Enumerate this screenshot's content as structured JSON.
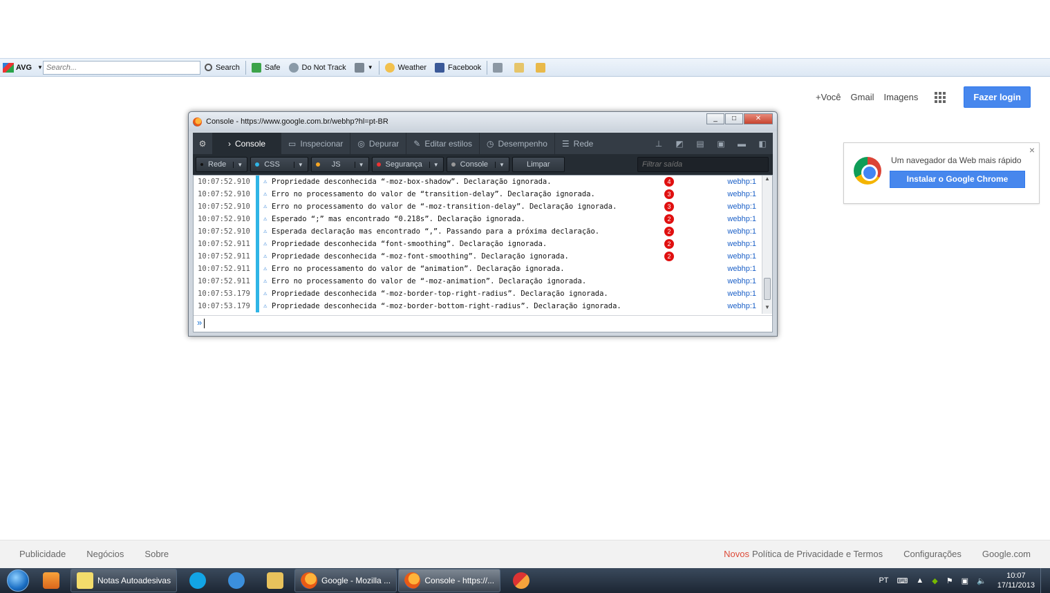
{
  "avg_toolbar": {
    "brand": "AVG",
    "search_placeholder": "Search...",
    "search_label": "Search",
    "safe_label": "Safe",
    "dnt_label": "Do Not Track",
    "weather_label": "Weather",
    "facebook_label": "Facebook"
  },
  "google_header": {
    "you_label": "+Você",
    "gmail_label": "Gmail",
    "images_label": "Imagens",
    "login_label": "Fazer login"
  },
  "chrome_promo": {
    "text": "Um navegador da Web mais rápido",
    "button_label": "Instalar o Google Chrome",
    "close": "×"
  },
  "console_window": {
    "title": "Console - https://www.google.com.br/webhp?hl=pt-BR",
    "tabs": [
      {
        "label": "Console",
        "icon": "›"
      },
      {
        "label": "Inspecionar",
        "icon": "▭"
      },
      {
        "label": "Depurar",
        "icon": "◎"
      },
      {
        "label": "Editar estilos",
        "icon": "✎"
      },
      {
        "label": "Desempenho",
        "icon": "◷"
      },
      {
        "label": "Rede",
        "icon": "☰"
      }
    ],
    "filters": {
      "net": "Rede",
      "css": "CSS",
      "js": "JS",
      "security": "Segurança",
      "logging": "Console",
      "clear": "Limpar",
      "search_placeholder": "Filtrar saída"
    },
    "rows": [
      {
        "time": "10:07:52.910",
        "msg": "Propriedade desconhecida “-moz-box-shadow”.  Declaração ignorada.",
        "count": "4",
        "src": "webhp:1"
      },
      {
        "time": "10:07:52.910",
        "msg": "Erro no processamento do valor de “transition-delay”.  Declaração ignorada.",
        "count": "3",
        "src": "webhp:1"
      },
      {
        "time": "10:07:52.910",
        "msg": "Erro no processamento do valor de “-moz-transition-delay”.  Declaração ignorada.",
        "count": "3",
        "src": "webhp:1"
      },
      {
        "time": "10:07:52.910",
        "msg": "Esperado “;” mas encontrado “0.218s”.  Declaração ignorada.",
        "count": "2",
        "src": "webhp:1"
      },
      {
        "time": "10:07:52.910",
        "msg": "Esperada declaração mas encontrado “,”.  Passando para a próxima declaração.",
        "count": "2",
        "src": "webhp:1"
      },
      {
        "time": "10:07:52.911",
        "msg": "Propriedade desconhecida “font-smoothing”.  Declaração ignorada.",
        "count": "2",
        "src": "webhp:1"
      },
      {
        "time": "10:07:52.911",
        "msg": "Propriedade desconhecida “-moz-font-smoothing”.  Declaração ignorada.",
        "count": "2",
        "src": "webhp:1"
      },
      {
        "time": "10:07:52.911",
        "msg": "Erro no processamento do valor de “animation”.  Declaração ignorada.",
        "count": "",
        "src": "webhp:1"
      },
      {
        "time": "10:07:52.911",
        "msg": "Erro no processamento do valor de “-moz-animation”.  Declaração ignorada.",
        "count": "",
        "src": "webhp:1"
      },
      {
        "time": "10:07:53.179",
        "msg": "Propriedade desconhecida “-moz-border-top-right-radius”.  Declaração ignorada.",
        "count": "",
        "src": "webhp:1"
      },
      {
        "time": "10:07:53.179",
        "msg": "Propriedade desconhecida “-moz-border-bottom-right-radius”.  Declaração ignorada.",
        "count": "",
        "src": "webhp:1"
      }
    ],
    "prompt": "»"
  },
  "google_footer": {
    "ads": "Publicidade",
    "business": "Negócios",
    "about": "Sobre",
    "new": "Novos",
    "privacy": "Política de Privacidade e Termos",
    "settings": "Configurações",
    "domain": "Google.com"
  },
  "taskbar": {
    "notes": "Notas Autoadesivas",
    "firefox_google": "Google - Mozilla ...",
    "firefox_console": "Console - https://...",
    "lang": "PT",
    "time": "10:07",
    "date": "17/11/2013"
  },
  "colors": {
    "accent_blue": "#4787ed",
    "console_bar": "#2fb5e6",
    "badge_red": "#e01010",
    "devtools_dark": "#343c45"
  }
}
